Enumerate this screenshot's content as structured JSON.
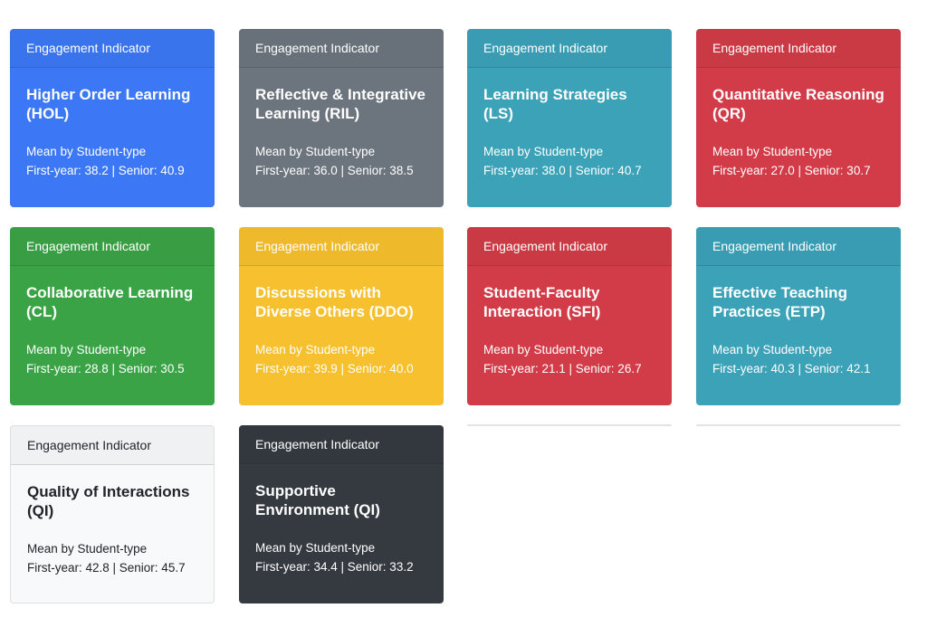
{
  "colors": {
    "primary": "#3c78f5",
    "secondary": "#6c757d",
    "info": "#3ba2b8",
    "danger": "#d13c48",
    "success": "#3aa346",
    "warning": "#f6c02e",
    "light": "#f8f9fa",
    "dark": "#343a40"
  },
  "cards": [
    {
      "header": "Engagement Indicator",
      "title_line1": "Higher Order Learning",
      "title_line2": "(HOL)",
      "mean_label": "Mean by Student-type",
      "stats": "First-year: 38.2 | Senior: 40.9"
    },
    {
      "header": "Engagement Indicator",
      "title_line1": "Reflective & Integrative",
      "title_line2": "Learning (RIL)",
      "mean_label": "Mean by Student-type",
      "stats": "First-year: 36.0 | Senior: 38.5"
    },
    {
      "header": "Engagement Indicator",
      "title_line1": "Learning Strategies",
      "title_line2": "(LS)",
      "mean_label": "Mean by Student-type",
      "stats": "First-year: 38.0 | Senior: 40.7"
    },
    {
      "header": "Engagement Indicator",
      "title_line1": "Quantitative Reasoning",
      "title_line2": "(QR)",
      "mean_label": "Mean by Student-type",
      "stats": "First-year: 27.0 | Senior: 30.7"
    },
    {
      "header": "Engagement Indicator",
      "title_line1": "Collaborative Learning",
      "title_line2": "(CL)",
      "mean_label": "Mean by Student-type",
      "stats": "First-year: 28.8 | Senior: 30.5"
    },
    {
      "header": "Engagement Indicator",
      "title_line1": "Discussions with",
      "title_line2": "Diverse Others (DDO)",
      "mean_label": "Mean by Student-type",
      "stats": "First-year: 39.9 | Senior: 40.0"
    },
    {
      "header": "Engagement Indicator",
      "title_line1": "Student-Faculty",
      "title_line2": "Interaction (SFI)",
      "mean_label": "Mean by Student-type",
      "stats": "First-year: 21.1 | Senior: 26.7"
    },
    {
      "header": "Engagement Indicator",
      "title_line1": "Effective Teaching",
      "title_line2": "Practices (ETP)",
      "mean_label": "Mean by Student-type",
      "stats": "First-year: 40.3 | Senior: 42.1"
    },
    {
      "header": "Engagement Indicator",
      "title_line1": "Quality of Interactions",
      "title_line2": "(QI)",
      "mean_label": "Mean by Student-type",
      "stats": "First-year: 42.8 | Senior: 45.7"
    },
    {
      "header": "Engagement Indicator",
      "title_line1": "Supportive",
      "title_line2": "Environment (QI)",
      "mean_label": "Mean by Student-type",
      "stats": "First-year: 34.4 | Senior: 33.2"
    }
  ]
}
